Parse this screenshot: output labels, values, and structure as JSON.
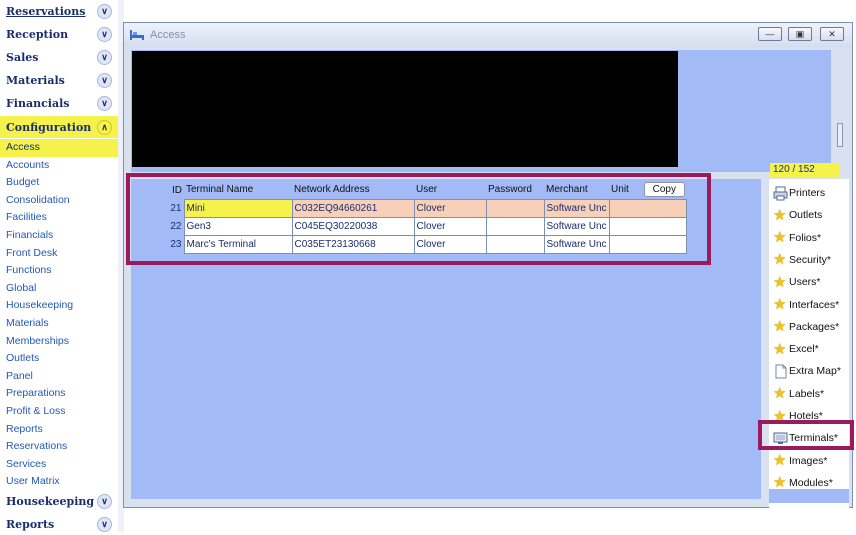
{
  "sidebar": {
    "sections": [
      {
        "label": "Reservations",
        "underlined": true
      },
      {
        "label": "Reception"
      },
      {
        "label": "Sales"
      },
      {
        "label": "Materials"
      },
      {
        "label": "Financials"
      },
      {
        "label": "Configuration",
        "active": true
      }
    ],
    "config_items": [
      "Access",
      "Accounts",
      "Budget",
      "Consolidation",
      "Facilities",
      "Financials",
      "Front Desk",
      "Functions",
      "Global",
      "Housekeeping",
      "Materials",
      "Memberships",
      "Outlets",
      "Panel",
      "Preparations",
      "Profit & Loss",
      "Reports",
      "Reservations",
      "Services",
      "User Matrix"
    ],
    "selected_item": "Access",
    "bottom_sections": [
      {
        "label": "Housekeeping"
      },
      {
        "label": "Reports"
      }
    ]
  },
  "window": {
    "title": "Access",
    "counter": "120 / 152",
    "copy_label": "Copy",
    "columns": [
      "ID",
      "Terminal Name",
      "Network Address",
      "User",
      "Password",
      "Merchant",
      "Unit"
    ],
    "rows": [
      {
        "id": "21",
        "name": "Mini",
        "address": "C032EQ94660261",
        "user": "Clover",
        "password": "",
        "merchant": "Software Unc",
        "unit": ""
      },
      {
        "id": "22",
        "name": "Gen3",
        "address": "C045EQ30220038",
        "user": "Clover",
        "password": "",
        "merchant": "Software Unc",
        "unit": ""
      },
      {
        "id": "23",
        "name": "Marc's Terminal",
        "address": "C035ET23130668",
        "user": "Clover",
        "password": "",
        "merchant": "Software Unc",
        "unit": ""
      }
    ],
    "right_items": [
      {
        "label": "Printers",
        "icon": "printer-icon"
      },
      {
        "label": "Outlets",
        "icon": "star-icon"
      },
      {
        "label": "Folios*",
        "icon": "star-icon"
      },
      {
        "label": "Security*",
        "icon": "star-icon"
      },
      {
        "label": "Users*",
        "icon": "star-icon"
      },
      {
        "label": "Interfaces*",
        "icon": "star-icon"
      },
      {
        "label": "Packages*",
        "icon": "star-icon"
      },
      {
        "label": "Excel*",
        "icon": "star-icon"
      },
      {
        "label": "Extra Map*",
        "icon": "document-icon"
      },
      {
        "label": "Labels*",
        "icon": "star-icon"
      },
      {
        "label": "Hotels*",
        "icon": "star-icon"
      },
      {
        "label": "Terminals*",
        "icon": "terminal-icon",
        "highlighted": true
      },
      {
        "label": "Images*",
        "icon": "star-icon"
      },
      {
        "label": "Modules*",
        "icon": "star-icon"
      }
    ]
  },
  "colors": {
    "accent_yellow": "#f4f24b",
    "panel_blue": "#a2bbf7",
    "highlight_box": "#9a1a5e",
    "nav_text": "#1a2d6e",
    "link_text": "#2357b5"
  }
}
